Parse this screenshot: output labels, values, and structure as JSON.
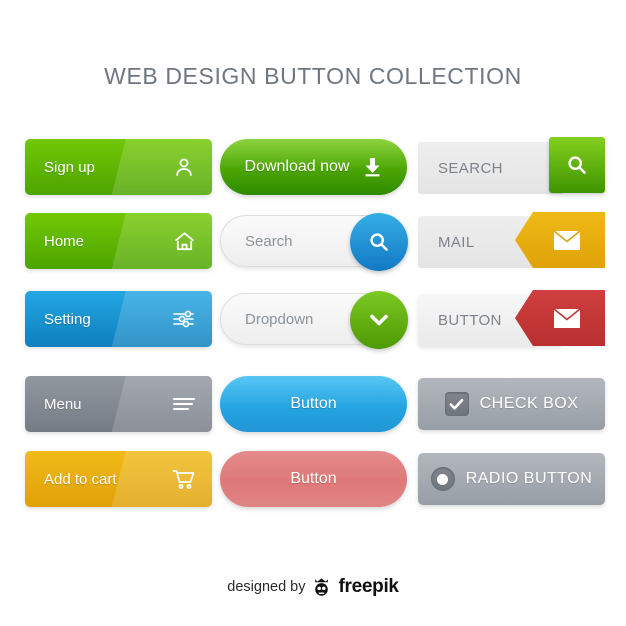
{
  "page": {
    "title": "WEB DESIGN BUTTON COLLECTION",
    "background": "#ffffff"
  },
  "footer": {
    "credit_text": "designed by",
    "brand": "freepik",
    "logo_icon": "freepik-crown-robot-icon"
  },
  "colors": {
    "green": "#72c805",
    "dark_green": "#4da400",
    "blue": "#25a7e4",
    "dark_blue": "#0d7fbd",
    "gray": "#9298a0",
    "gold": "#f0bb18",
    "red": "#cf3f3f",
    "light_gray_field": "#eeeeee",
    "title_text": "#6f7680",
    "field_text": "#8d939b"
  },
  "buttons": {
    "column1": [
      {
        "id": "sign-up",
        "label": "Sign up",
        "icon": "user-icon",
        "style": "solid-green"
      },
      {
        "id": "home",
        "label": "Home",
        "icon": "home-icon",
        "style": "solid-green"
      },
      {
        "id": "setting",
        "label": "Setting",
        "icon": "sliders-icon",
        "style": "solid-blue"
      },
      {
        "id": "menu",
        "label": "Menu",
        "icon": "hamburger-icon",
        "style": "solid-gray"
      },
      {
        "id": "add-to-cart",
        "label": "Add to cart",
        "icon": "cart-icon",
        "style": "solid-gold"
      }
    ],
    "column2": [
      {
        "id": "download-now",
        "label": "Download now",
        "icon": "download-icon",
        "style": "pill-green"
      },
      {
        "id": "search-field",
        "label": "Search",
        "icon": "search-icon",
        "style": "field-blue-knob"
      },
      {
        "id": "dropdown",
        "label": "Dropdown",
        "icon": "chevron-down-icon",
        "style": "field-green-knob"
      },
      {
        "id": "blue-button",
        "label": "Button",
        "icon": "",
        "style": "pill-blue"
      },
      {
        "id": "red-button",
        "label": "Button",
        "icon": "",
        "style": "pill-red"
      }
    ],
    "column3": [
      {
        "id": "search-box",
        "label": "SEARCH",
        "icon": "search-icon",
        "style": "split-green-square"
      },
      {
        "id": "mail-box",
        "label": "MAIL",
        "icon": "envelope-icon",
        "style": "split-gold-notch"
      },
      {
        "id": "button-box",
        "label": "BUTTON",
        "icon": "envelope-icon",
        "style": "split-red-notch"
      },
      {
        "id": "check-box",
        "label": "CHECK BOX",
        "icon": "checkmark-icon",
        "style": "ctrl-gray"
      },
      {
        "id": "radio-button",
        "label": "RADIO BUTTON",
        "icon": "radio-dot-icon",
        "style": "ctrl-gray"
      }
    ]
  }
}
